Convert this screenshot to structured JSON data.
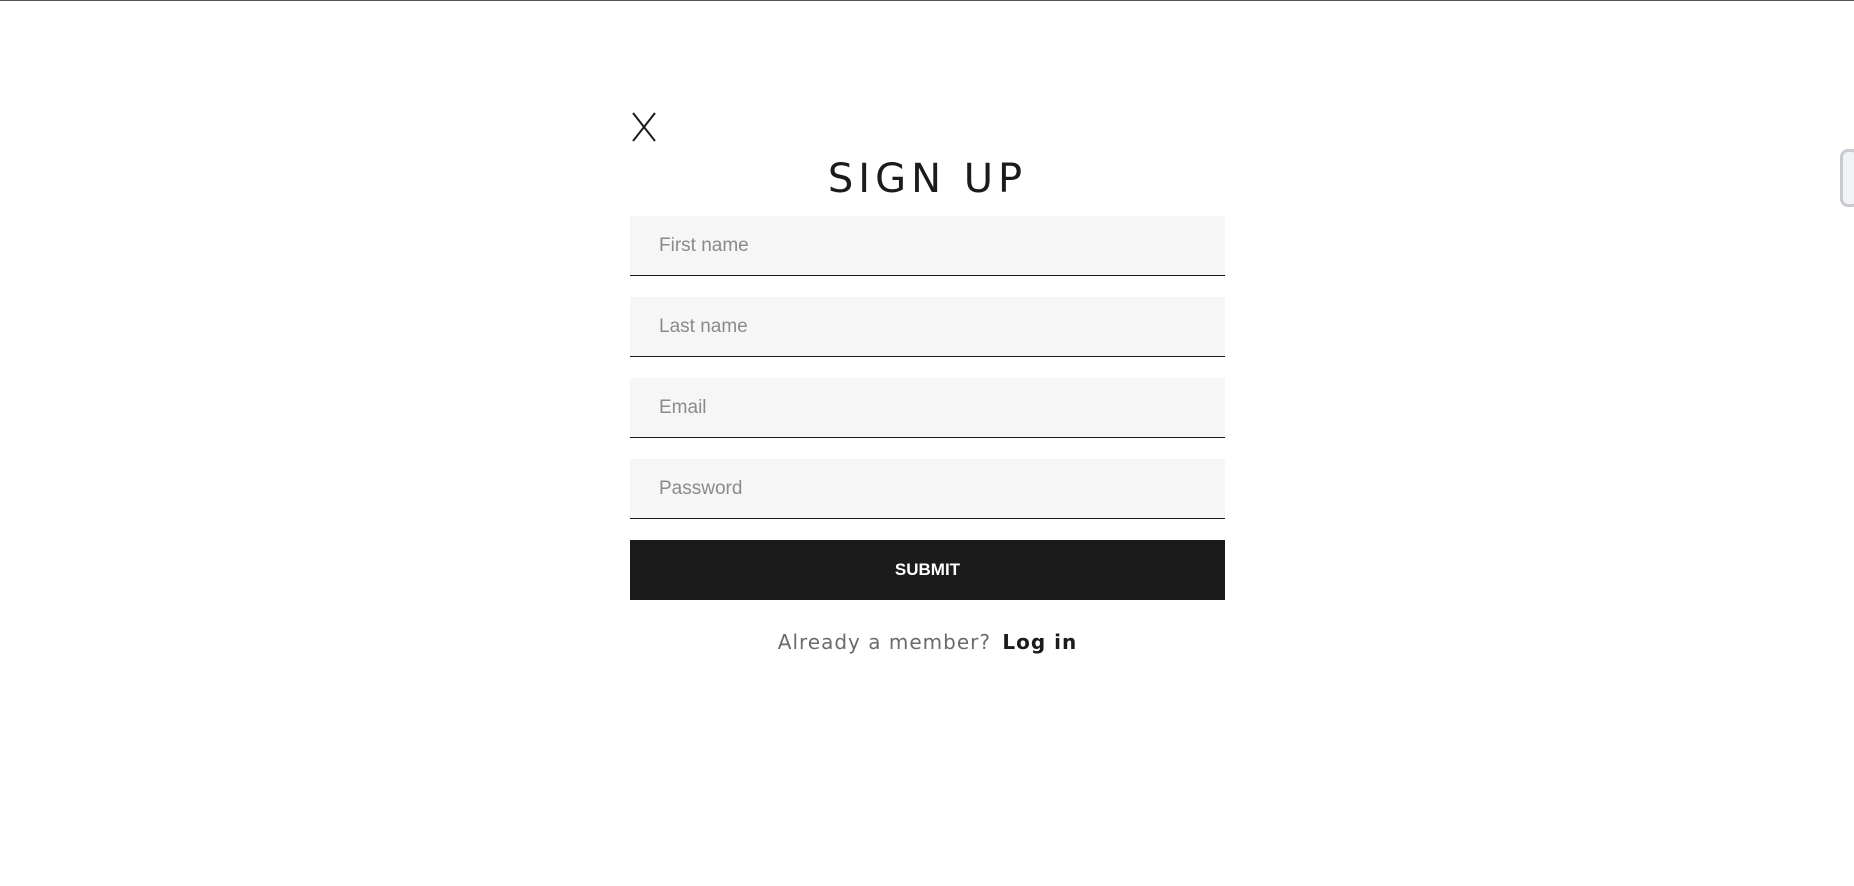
{
  "modal": {
    "close_label": "X",
    "title": "SIGN UP",
    "fields": {
      "first_name": {
        "placeholder": "First name",
        "value": ""
      },
      "last_name": {
        "placeholder": "Last name",
        "value": ""
      },
      "email": {
        "placeholder": "Email",
        "value": ""
      },
      "password": {
        "placeholder": "Password",
        "value": ""
      }
    },
    "submit_label": "SUBMIT",
    "member_prompt": "Already a member?",
    "login_label": "Log in"
  },
  "colors": {
    "text_dark": "#1b1b1b",
    "field_bg": "#f6f6f7",
    "button_bg": "#1b1b1b",
    "muted_text": "#6b6b6b"
  }
}
